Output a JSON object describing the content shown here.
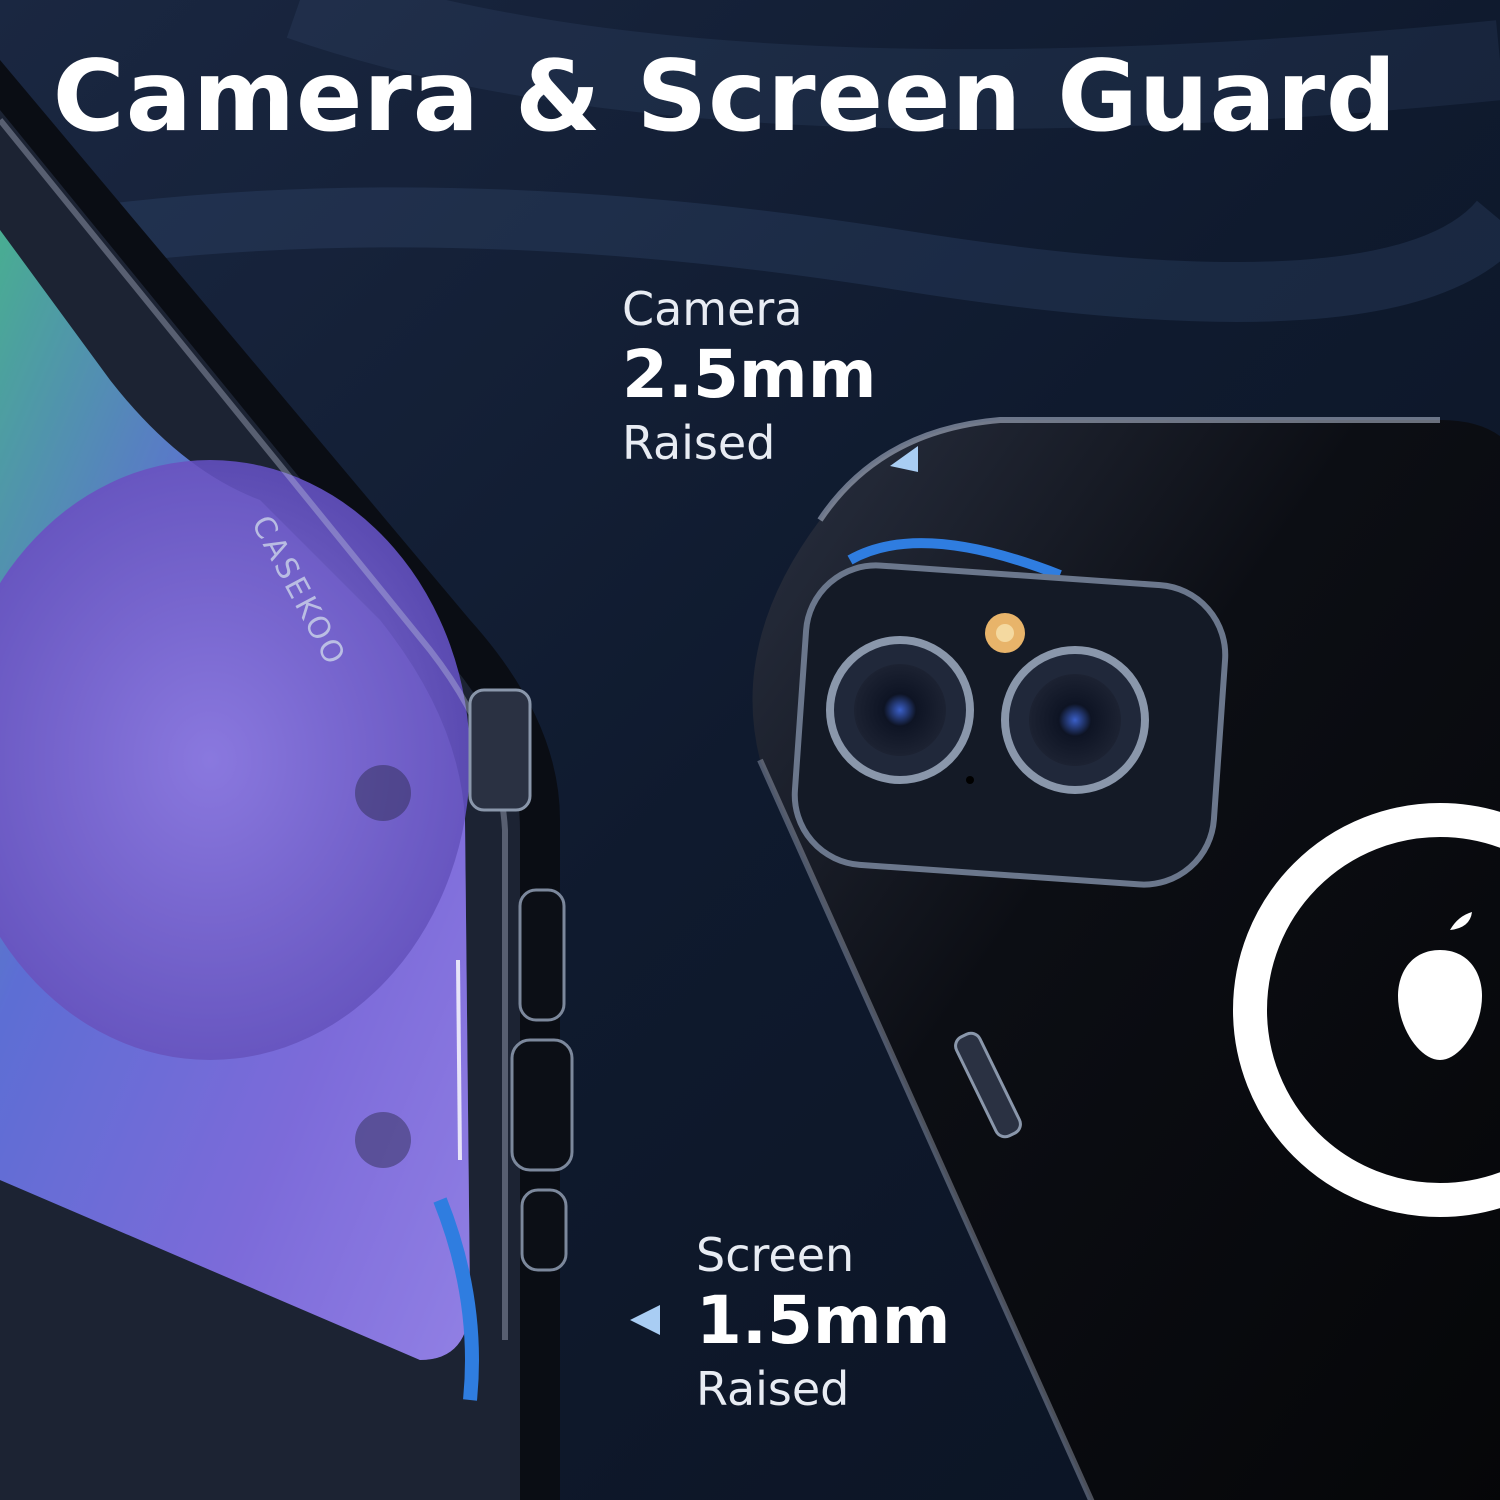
{
  "headline": "Camera & Screen Guard",
  "camera_spec": {
    "label": "Camera",
    "value": "2.5mm",
    "suffix": "Raised"
  },
  "screen_spec": {
    "label": "Screen",
    "value": "1.5mm",
    "suffix": "Raised"
  },
  "brand": "CASEKOO",
  "colors": {
    "background": "#101a2c",
    "accent_blue": "#2f7de0",
    "arrow": "#a9cdf3",
    "text": "#ffffff"
  }
}
